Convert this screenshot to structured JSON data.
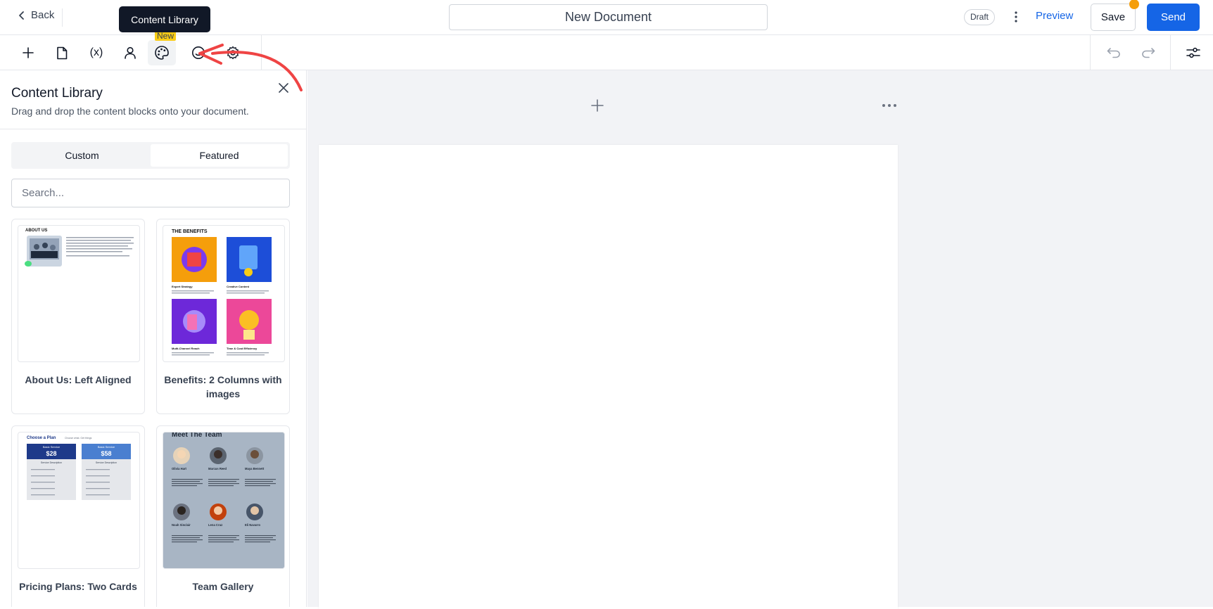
{
  "header": {
    "back_label": "Back",
    "document_title": "New Document",
    "status_badge": "Draft",
    "preview_label": "Preview",
    "save_label": "Save",
    "send_label": "Send"
  },
  "toolbar": {
    "new_badge": "New",
    "tooltip": "Content Library",
    "variables_label": "(x)"
  },
  "library": {
    "title": "Content Library",
    "subtitle": "Drag and drop the content blocks onto your document.",
    "tabs": [
      {
        "label": "Custom",
        "active": false
      },
      {
        "label": "Featured",
        "active": true
      }
    ],
    "search_placeholder": "Search...",
    "cards": [
      {
        "label": "About Us: Left Aligned",
        "preview": {
          "heading": "ABOUT US"
        }
      },
      {
        "label": "Benefits: 2 Columns with images",
        "preview": {
          "heading": "THE BENEFITS",
          "items": [
            "Expert Strategy",
            "Creative Content",
            "Multi-Channel Reach",
            "Time & Cost Efficiency"
          ]
        }
      },
      {
        "label": "Pricing Plans: Two Cards",
        "preview": {
          "heading": "Choose a Plan",
          "subheading": "Choose what. Get things",
          "plans": [
            {
              "name": "Basic Service",
              "price": "$28",
              "desc": "Service Description"
            },
            {
              "name": "Basic Service",
              "price": "$58",
              "desc": "Service Description"
            }
          ]
        }
      },
      {
        "label": "Team Gallery",
        "preview": {
          "heading": "Meet The Team",
          "members": [
            "Olivia Hart",
            "Marcus Reed",
            "Maya Bennett",
            "Noah Sinclair",
            "Lena Cruz",
            "Eli Navarro"
          ]
        }
      }
    ]
  },
  "colors": {
    "accent": "#1565e6",
    "badge_yellow": "#facc15",
    "notify_orange": "#f59e0b",
    "annotation_red": "#ef4444",
    "canvas_bg": "#f2f3f6"
  }
}
